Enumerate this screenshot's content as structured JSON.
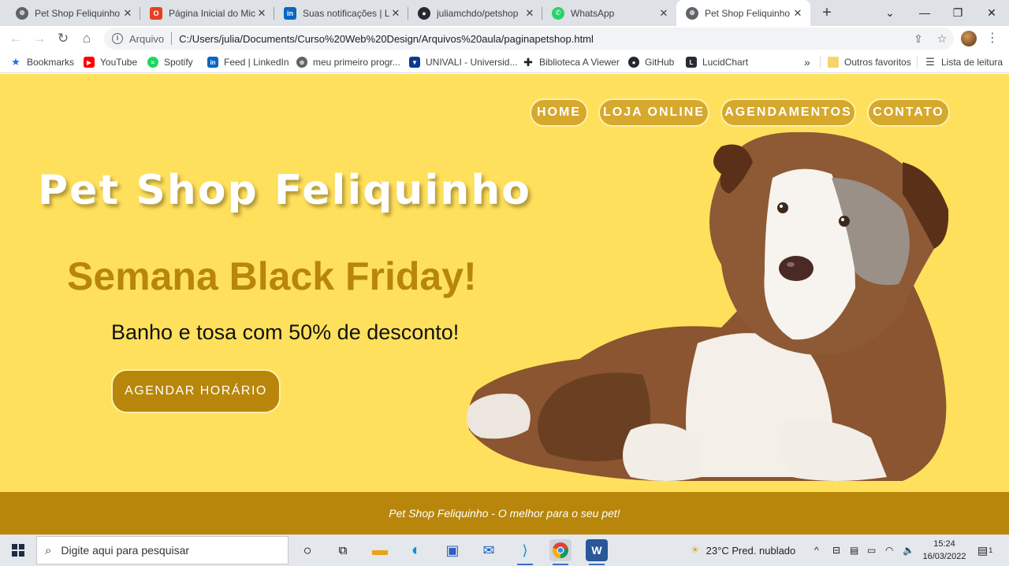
{
  "browser": {
    "tabs": [
      {
        "title": "Pet Shop Feliquinho",
        "icon": "globe-icon",
        "active": false
      },
      {
        "title": "Página Inicial do Micr",
        "icon": "office-icon",
        "active": false
      },
      {
        "title": "Suas notificações | Lin",
        "icon": "linkedin-icon",
        "active": false
      },
      {
        "title": "juliamchdo/petshop",
        "icon": "github-icon",
        "active": false
      },
      {
        "title": "WhatsApp",
        "icon": "whatsapp-icon",
        "active": false
      },
      {
        "title": "Pet Shop Feliquinho",
        "icon": "globe-icon",
        "active": true
      }
    ],
    "address": {
      "protocol_label": "Arquivo",
      "url": "C:/Users/julia/Documents/Curso%20Web%20Design/Arquivos%20aula/paginapetshop.html"
    },
    "bookmarks": [
      {
        "label": "Bookmarks",
        "icon": "star-icon"
      },
      {
        "label": "YouTube",
        "icon": "youtube-icon"
      },
      {
        "label": "Spotify",
        "icon": "spotify-icon"
      },
      {
        "label": "Feed | LinkedIn",
        "icon": "linkedin-icon"
      },
      {
        "label": "meu primeiro progr...",
        "icon": "globe-icon"
      },
      {
        "label": "UNIVALI - Universid...",
        "icon": "univali-icon"
      },
      {
        "label": "Biblioteca A Viewer",
        "icon": "plus-icon"
      },
      {
        "label": "GitHub",
        "icon": "github-icon"
      },
      {
        "label": "LucidChart",
        "icon": "lucidchart-icon"
      }
    ],
    "bookmarks_overflow": "»",
    "other_favorites": "Outros favoritos",
    "reading_list": "Lista de leitura"
  },
  "site": {
    "nav": [
      "HOME",
      "LOJA ONLINE",
      "AGENDAMENTOS",
      "CONTATO"
    ],
    "title": "Pet Shop Feliquinho",
    "promo_title": "Semana Black Friday!",
    "promo_subtitle": "Banho e tosa com 50% de desconto!",
    "cta": "AGENDAR HORÁRIO",
    "footer": "Pet Shop Feliquinho - O melhor para o seu pet!"
  },
  "taskbar": {
    "search_placeholder": "Digite aqui para pesquisar",
    "weather": "23°C  Pred. nublado",
    "time": "15:24",
    "date": "16/03/2022",
    "notification_count": "1"
  },
  "colors": {
    "page_background": "#ffe05c",
    "accent": "#b8860b",
    "nav_pill": "#d6a82c"
  }
}
